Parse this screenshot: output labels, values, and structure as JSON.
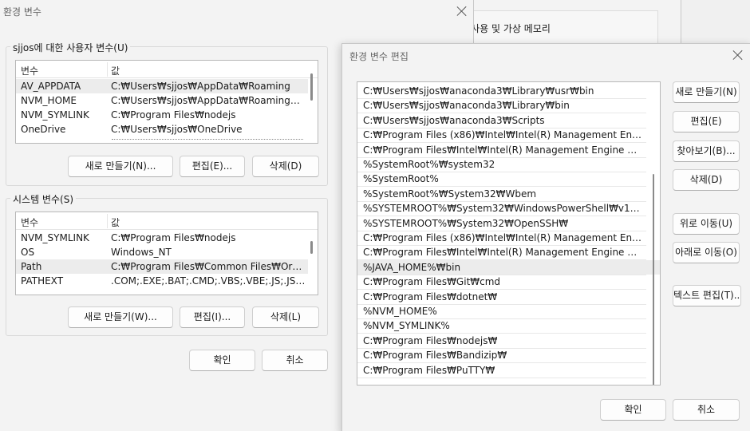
{
  "env_dialog": {
    "title": "환경 변수",
    "user_group_label": "sjjos에 대한 사용자 변수(U)",
    "system_group_label": "시스템 변수(S)",
    "col_name": "변수",
    "col_value": "값",
    "user_vars": [
      {
        "name": "AV_APPDATA",
        "value": "C:₩Users₩sjjos₩AppData₩Roaming"
      },
      {
        "name": "NVM_HOME",
        "value": "C:₩Users₩sjjos₩AppData₩Roaming₩nvm"
      },
      {
        "name": "NVM_SYMLINK",
        "value": "C:₩Program Files₩nodejs"
      },
      {
        "name": "OneDrive",
        "value": "C:₩Users₩sjjos₩OneDrive"
      }
    ],
    "system_vars": [
      {
        "name": "NVM_SYMLINK",
        "value": "C:₩Program Files₩nodejs"
      },
      {
        "name": "OS",
        "value": "Windows_NT"
      },
      {
        "name": "Path",
        "value": "C:₩Program Files₩Common Files₩Oracle₩..."
      },
      {
        "name": "PATHEXT",
        "value": ".COM;.EXE;.BAT;.CMD;.VBS;.VBE;.JS;.JSE;.W..."
      }
    ],
    "user_buttons": {
      "new": "새로 만들기(N)...",
      "edit": "편집(E)...",
      "delete": "삭제(D)"
    },
    "system_buttons": {
      "new": "새로 만들기(W)...",
      "edit": "편집(I)...",
      "delete": "삭제(L)"
    },
    "ok": "확인",
    "cancel": "취소"
  },
  "background_window": {
    "text": "l 사용 및 가상 메모리"
  },
  "edit_dialog": {
    "title": "환경 변수 편집",
    "entries": [
      "C:₩Users₩sjjos₩anaconda3₩Library₩usr₩bin",
      "C:₩Users₩sjjos₩anaconda3₩Library₩bin",
      "C:₩Users₩sjjos₩anaconda3₩Scripts",
      "C:₩Program Files (x86)₩Intel₩Intel(R) Management Engine Com...",
      "C:₩Program Files₩Intel₩Intel(R) Management Engine Componen...",
      "%SystemRoot%₩system32",
      "%SystemRoot%",
      "%SystemRoot%₩System32₩Wbem",
      "%SYSTEMROOT%₩System32₩WindowsPowerShell₩v1.0₩",
      "%SYSTEMROOT%₩System32₩OpenSSH₩",
      "C:₩Program Files (x86)₩Intel₩Intel(R) Management Engine Com...",
      "C:₩Program Files₩Intel₩Intel(R) Management Engine Componen...",
      "%JAVA_HOME%₩bin",
      "C:₩Program Files₩Git₩cmd",
      "C:₩Program Files₩dotnet₩",
      "%NVM_HOME%",
      "%NVM_SYMLINK%",
      "C:₩Program Files₩nodejs₩",
      "C:₩Program Files₩Bandizip₩",
      "C:₩Program Files₩PuTTY₩"
    ],
    "selected_index": 12,
    "buttons": {
      "new": "새로 만들기(N)",
      "edit": "편집(E)",
      "browse": "찾아보기(B)...",
      "delete": "삭제(D)",
      "move_up": "위로 이동(U)",
      "move_down": "아래로 이동(O)",
      "edit_text": "텍스트 편집(T)..."
    },
    "ok": "확인",
    "cancel": "취소"
  }
}
